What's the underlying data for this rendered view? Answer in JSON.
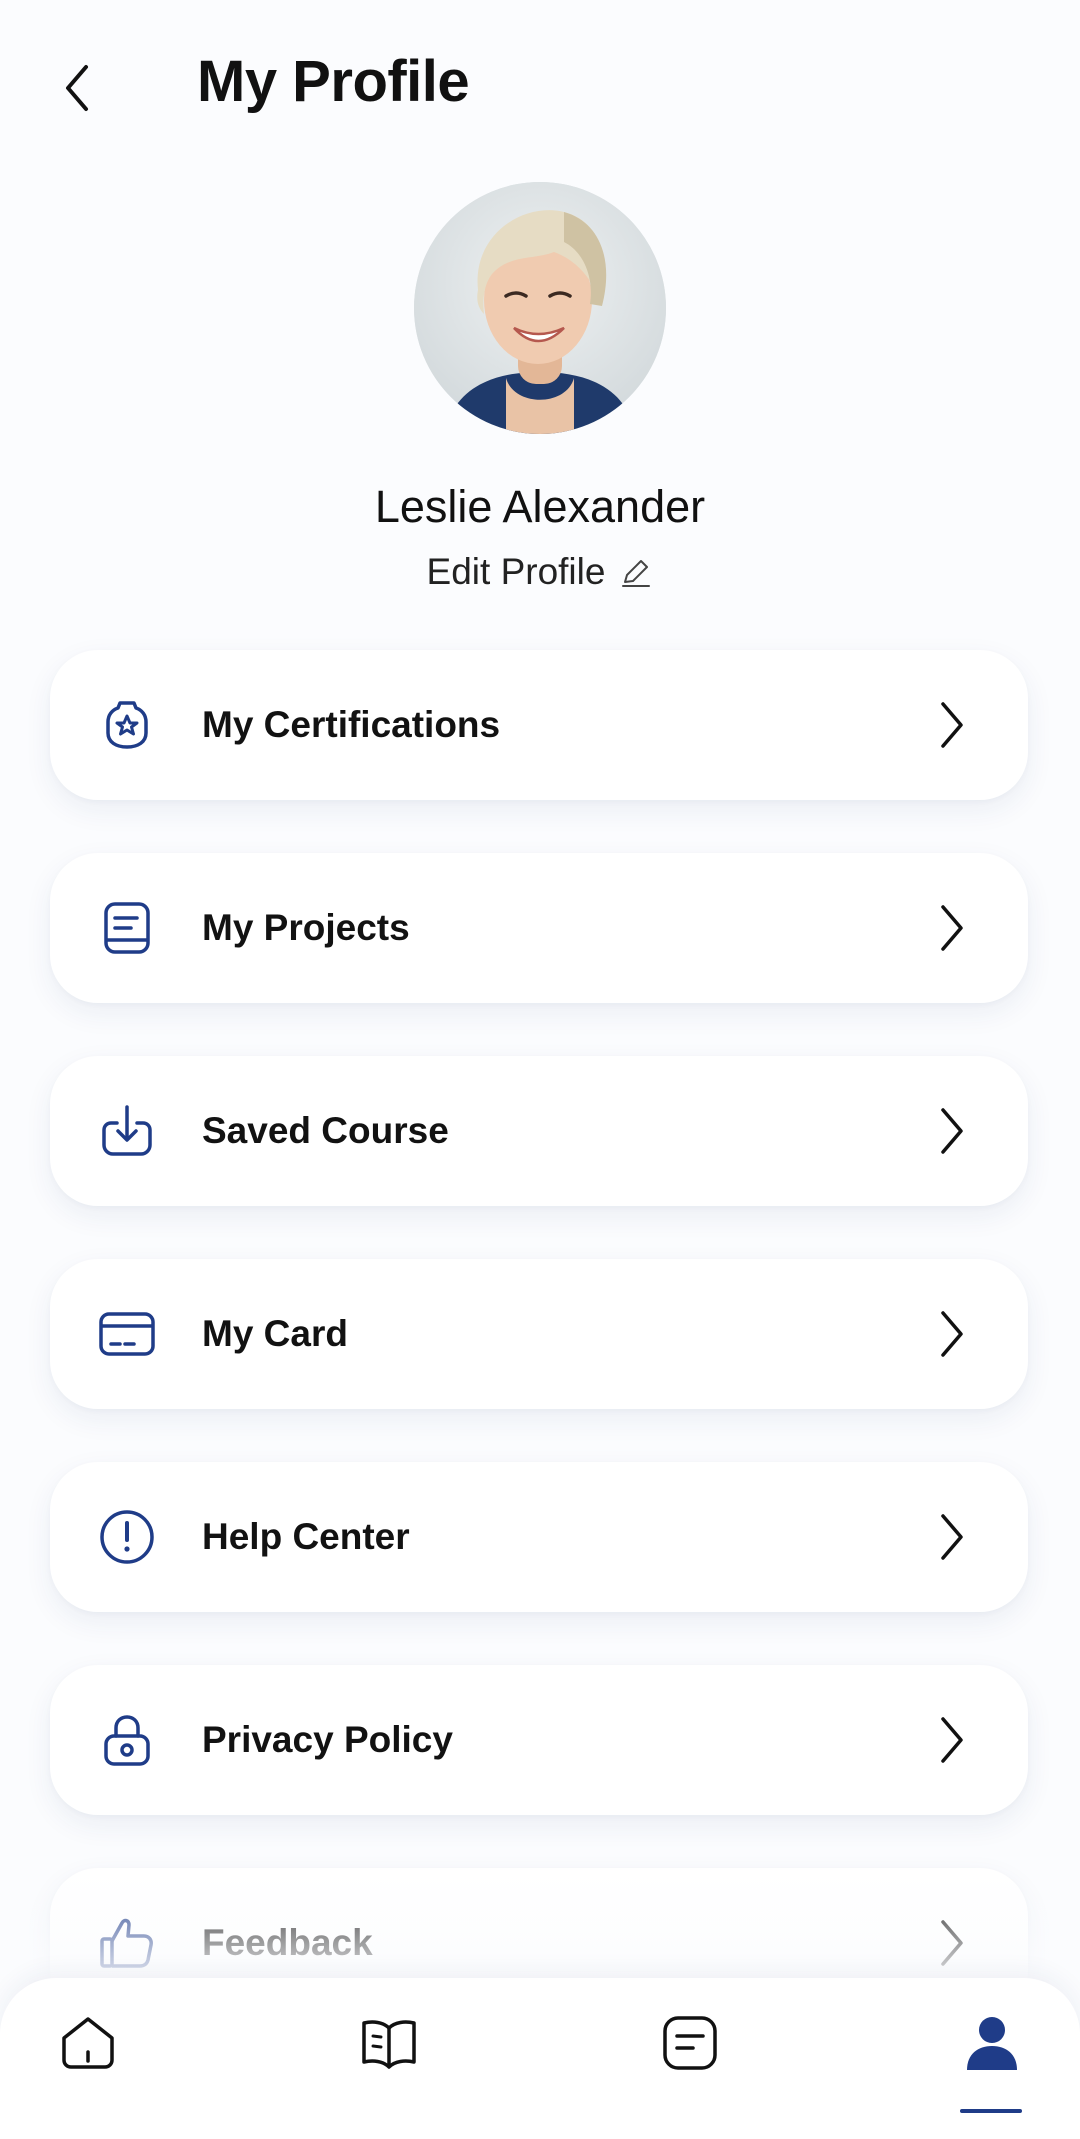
{
  "header": {
    "title": "My Profile",
    "back_icon": "chevron-left-icon"
  },
  "profile": {
    "name": "Leslie Alexander",
    "edit_label": "Edit Profile",
    "edit_icon": "pencil-icon"
  },
  "menu": {
    "items": [
      {
        "label": "My Certifications",
        "icon": "certificate-badge-icon"
      },
      {
        "label": "My Projects",
        "icon": "document-icon"
      },
      {
        "label": "Saved Course",
        "icon": "download-tray-icon"
      },
      {
        "label": "My Card",
        "icon": "credit-card-icon"
      },
      {
        "label": "Help Center",
        "icon": "exclamation-circle-icon"
      },
      {
        "label": "Privacy Policy",
        "icon": "lock-icon"
      },
      {
        "label": "Feedback",
        "icon": "thumbs-up-icon"
      }
    ]
  },
  "bottom_nav": {
    "items": [
      {
        "name": "home",
        "icon": "home-icon"
      },
      {
        "name": "courses",
        "icon": "open-book-icon"
      },
      {
        "name": "notes",
        "icon": "notes-icon"
      },
      {
        "name": "profile",
        "icon": "user-icon",
        "active": true
      }
    ]
  },
  "colors": {
    "accent": "#1f3c88",
    "text": "#111111",
    "background": "#fbfcfe"
  }
}
